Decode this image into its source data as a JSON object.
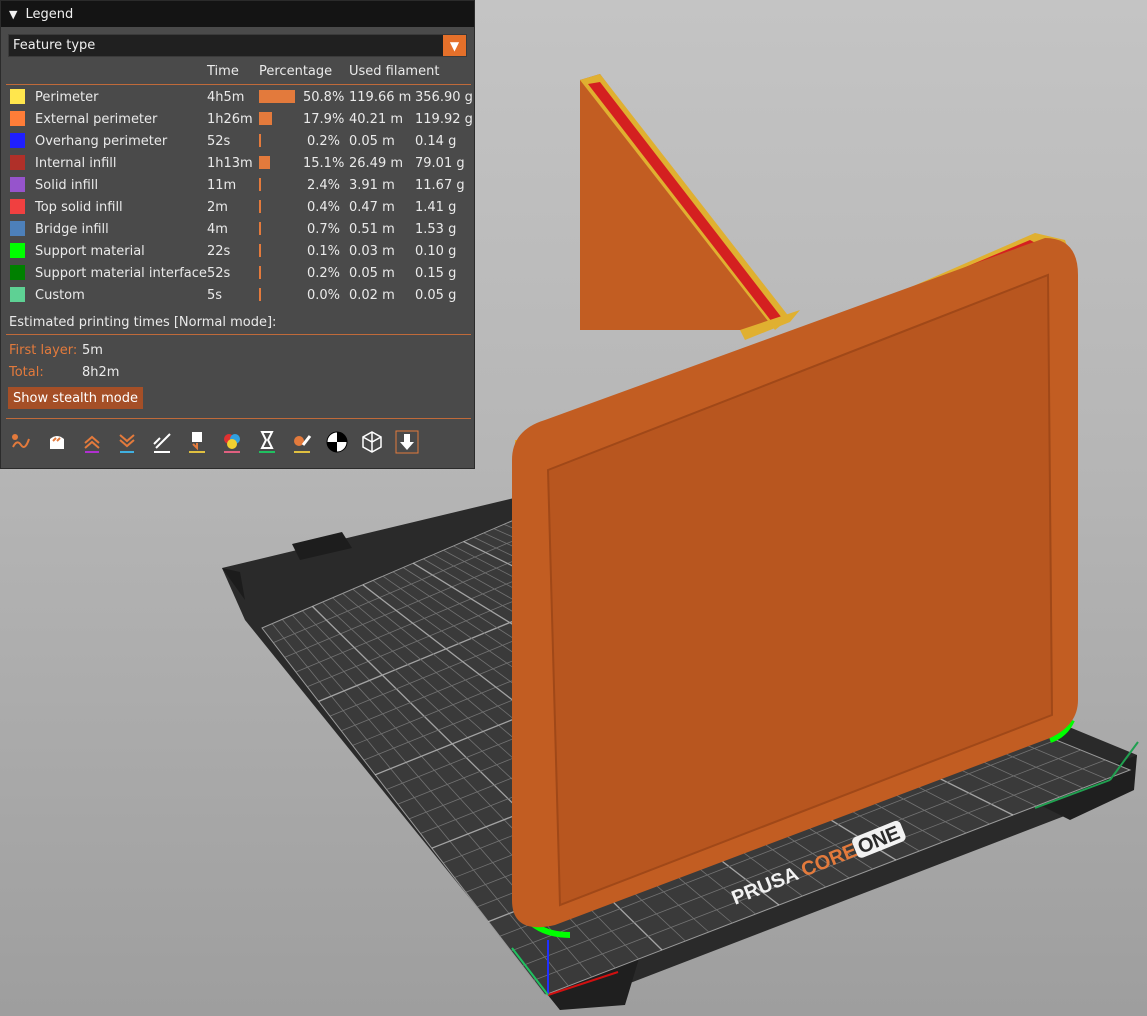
{
  "legend": {
    "title": "Legend",
    "view_type": "Feature type",
    "columns": {
      "time": "Time",
      "percentage": "Percentage",
      "used_filament": "Used filament"
    },
    "rows": [
      {
        "label": "Perimeter",
        "time": "4h5m",
        "pct": "50.8%",
        "pct_value": 50.8,
        "length": "119.66 m",
        "weight": "356.90 g",
        "color": "#ffe64d"
      },
      {
        "label": "External perimeter",
        "time": "1h26m",
        "pct": "17.9%",
        "pct_value": 17.9,
        "length": "40.21 m",
        "weight": "119.92 g",
        "color": "#ff7d38"
      },
      {
        "label": "Overhang perimeter",
        "time": "52s",
        "pct": "0.2%",
        "pct_value": 0.2,
        "length": "0.05 m",
        "weight": "0.14 g",
        "color": "#1f1fff"
      },
      {
        "label": "Internal infill",
        "time": "1h13m",
        "pct": "15.1%",
        "pct_value": 15.1,
        "length": "26.49 m",
        "weight": "79.01 g",
        "color": "#b03029"
      },
      {
        "label": "Solid infill",
        "time": "11m",
        "pct": "2.4%",
        "pct_value": 2.4,
        "length": "3.91 m",
        "weight": "11.67 g",
        "color": "#9654cc"
      },
      {
        "label": "Top solid infill",
        "time": "2m",
        "pct": "0.4%",
        "pct_value": 0.4,
        "length": "0.47 m",
        "weight": "1.41 g",
        "color": "#f04040"
      },
      {
        "label": "Bridge infill",
        "time": "4m",
        "pct": "0.7%",
        "pct_value": 0.7,
        "length": "0.51 m",
        "weight": "1.53 g",
        "color": "#4d80ba"
      },
      {
        "label": "Support material",
        "time": "22s",
        "pct": "0.1%",
        "pct_value": 0.1,
        "length": "0.03 m",
        "weight": "0.10 g",
        "color": "#00ff00"
      },
      {
        "label": "Support material interface",
        "time": "52s",
        "pct": "0.2%",
        "pct_value": 0.2,
        "length": "0.05 m",
        "weight": "0.15 g",
        "color": "#008000"
      },
      {
        "label": "Custom",
        "time": "5s",
        "pct": "0.0%",
        "pct_value": 0.0,
        "length": "0.02 m",
        "weight": "0.05 g",
        "color": "#5ed194"
      }
    ],
    "estimated_title": "Estimated printing times [Normal mode]:",
    "first_layer_label": "First layer:",
    "first_layer_value": "5m",
    "total_label": "Total:",
    "total_value": "8h2m",
    "stealth_button": "Show stealth mode",
    "toolbar": [
      "travel-icon",
      "wipe-icon",
      "retractions-icon",
      "deretractions-icon",
      "seams-icon",
      "tool-changes-icon",
      "color-changes-icon",
      "pause-icon",
      "custom-gcode-icon",
      "center-of-gravity-icon",
      "shells-icon",
      "tool-marker-icon"
    ]
  },
  "bed": {
    "brand_left": "PRUSA",
    "brand_mid": "CORE",
    "brand_right": "ONE"
  },
  "colors": {
    "accent": "#e37a3c",
    "model": "#c25d22",
    "panel_bg": "#4a4a4a"
  }
}
